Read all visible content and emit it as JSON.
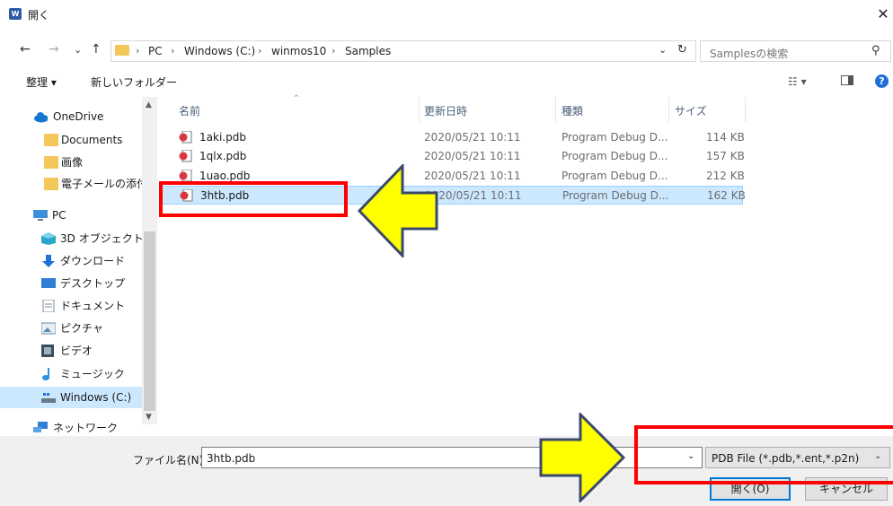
{
  "window": {
    "title": "開く",
    "close": "✕"
  },
  "nav": {
    "back": "←",
    "forward": "→",
    "recent": "⌄",
    "up": "↑",
    "breadcrumbs": [
      "PC",
      "Windows (C:)",
      "winmos10",
      "Samples"
    ],
    "separator": "›",
    "search_placeholder": "Samplesの検索"
  },
  "toolbar": {
    "organize": "整理 ▾",
    "new_folder": "新しいフォルダー"
  },
  "sidebar": {
    "items": [
      {
        "label": "OneDrive",
        "icon": "cloud-icon",
        "color": "#1777d1"
      },
      {
        "label": "Documents",
        "icon": "folder-icon",
        "color": "#f4c75b"
      },
      {
        "label": "画像",
        "icon": "folder-icon",
        "color": "#f4c75b"
      },
      {
        "label": "電子メールの添付フ",
        "icon": "folder-icon",
        "color": "#f4c75b"
      },
      {
        "label": "PC",
        "icon": "pc-icon",
        "color": "#3c8fd8"
      },
      {
        "label": "3D オブジェクト",
        "icon": "cube-icon",
        "color": "#2aa7c8"
      },
      {
        "label": "ダウンロード",
        "icon": "download-icon",
        "color": "#1f6fd6"
      },
      {
        "label": "デスクトップ",
        "icon": "desktop-icon",
        "color": "#2f7fd3"
      },
      {
        "label": "ドキュメント",
        "icon": "document-icon",
        "color": "#7a8a99"
      },
      {
        "label": "ピクチャ",
        "icon": "picture-icon",
        "color": "#5b8fb5"
      },
      {
        "label": "ビデオ",
        "icon": "video-icon",
        "color": "#3b4c5a"
      },
      {
        "label": "ミュージック",
        "icon": "music-icon",
        "color": "#2a8fe0"
      },
      {
        "label": "Windows (C:)",
        "icon": "drive-icon",
        "color": "#6a7a88"
      },
      {
        "label": "ネットワーク",
        "icon": "network-icon",
        "color": "#2f7fd3"
      }
    ]
  },
  "columns": {
    "name": "名前",
    "date": "更新日時",
    "type": "種類",
    "size": "サイズ"
  },
  "files": [
    {
      "name": "1aki.pdb",
      "date": "2020/05/21 10:11",
      "type": "Program Debug D...",
      "size": "114 KB"
    },
    {
      "name": "1qlx.pdb",
      "date": "2020/05/21 10:11",
      "type": "Program Debug D...",
      "size": "157 KB"
    },
    {
      "name": "1uao.pdb",
      "date": "2020/05/21 10:11",
      "type": "Program Debug D...",
      "size": "212 KB"
    },
    {
      "name": "3htb.pdb",
      "date": "2020/05/21 10:11",
      "type": "Program Debug D...",
      "size": "162 KB"
    }
  ],
  "selected_file": "3htb.pdb",
  "bottom": {
    "filename_label": "ファイル名(N):",
    "filename_value": "3htb.pdb",
    "filetype_value": "PDB File (*.pdb,*.ent,*.p2n)",
    "open_label": "開く(O)",
    "cancel_label": "キャンセル"
  },
  "colors": {
    "accent": "#0078d7",
    "selection": "#cce8ff",
    "annotation_box": "#ff0000",
    "annotation_arrow": "#ffff00"
  }
}
